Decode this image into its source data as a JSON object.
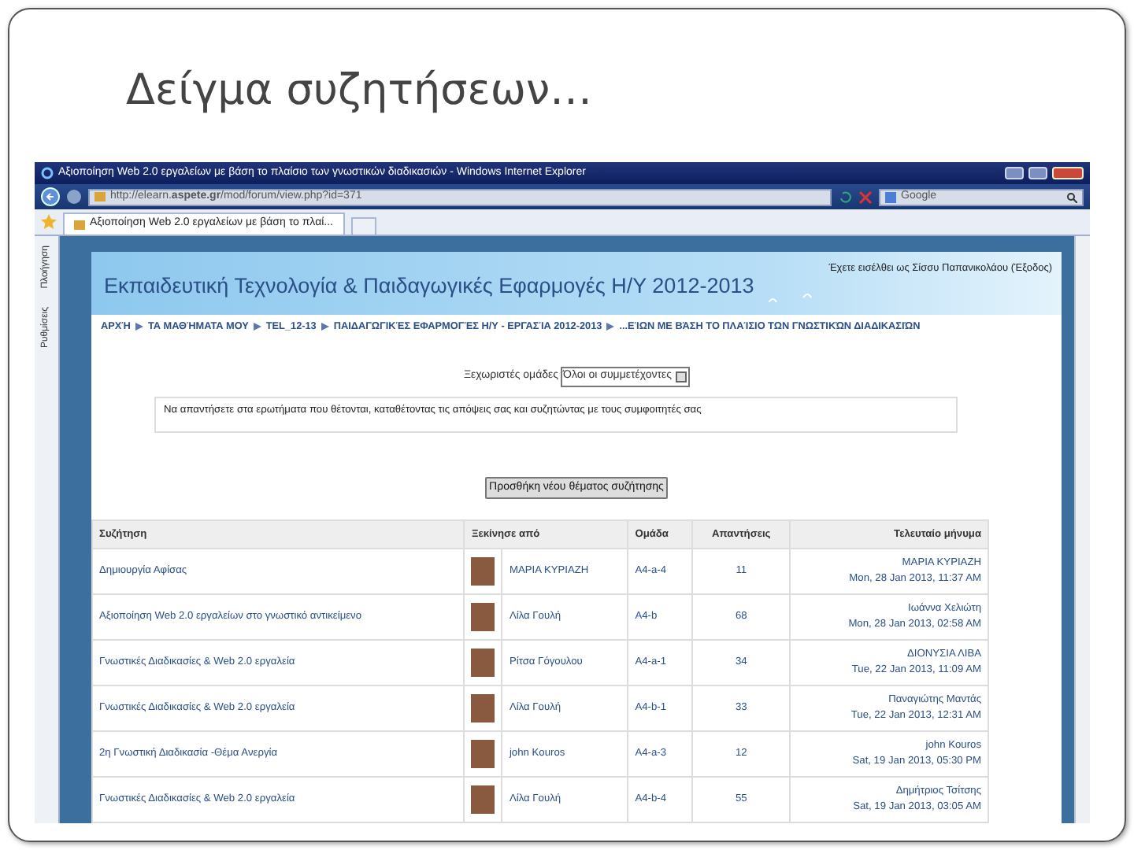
{
  "slide": {
    "title": "Δείγμα συζητήσεων…"
  },
  "browser": {
    "window_title": "Αξιοποίηση Web 2.0 εργαλείων με βάση το πλαίσιο των γνωστικών διαδικασιών - Windows Internet Explorer",
    "address": "http://elearn.**aspete.gr**/mod/forum/view.php?id=371",
    "search_placeholder": "Google",
    "tab": "Αξιοποίηση Web 2.0 εργαλείων με βάση το πλαί...",
    "side_tabs": [
      "Πλοήγηση",
      "Ρυθμίσεις"
    ]
  },
  "page": {
    "login_text": "Έχετε εισέλθει ως Σίσσυ Παπανικολάου (Έξοδος)",
    "course_title": "Εκπαιδευτική Τεχνολογία & Παιδαγωγικές Εφαρμογές Η/Υ 2012-2013",
    "breadcrumb": [
      "ΑΡΧΉ",
      "ΤΑ ΜΑΘΉΜΑΤΑ ΜΟΥ",
      "TEL_12-13",
      "ΠΑΙΔΑΓΩΓΙΚΈΣ ΕΦΑΡΜΟΓΈΣ Η/Υ - ΕΡΓΑΣΊΑ 2012-2013",
      "...ΕΊΩΝ ΜΕ ΒΆΣΗ ΤΟ ΠΛΑΊΣΙΟ ΤΩΝ ΓΝΩΣΤΙΚΏΝ ΔΙΑΔΙΚΑΣΙΏΝ"
    ],
    "groups": {
      "label": "Ξεχωριστές ομάδες",
      "value": "Όλοι οι συμμετέχοντες"
    },
    "intro": "Να απαντήσετε στα ερωτήματα που θέτονται, καταθέτοντας τις απόψεις σας και συζητώντας με τους συμφοιτητές σας",
    "add_button": "Προσθήκη νέου θέματος συζήτησης"
  },
  "table": {
    "columns": [
      "Συζήτηση",
      "Ξεκίνησε από",
      "Ομάδα",
      "Απαντήσεις",
      "Τελευταίο μήνυμα"
    ],
    "rows": [
      {
        "discussion": "Δημιουργία Αφίσας",
        "started_by": "ΜΑΡΙΑ ΚΥΡΙΑΖΗ",
        "group": "A4-a-4",
        "replies": "11",
        "last_author": "ΜΑΡΙΑ ΚΥΡΙΑΖΗ",
        "last_date": "Mon, 28 Jan 2013, 11:37 AM"
      },
      {
        "discussion": "Αξιοποίηση Web 2.0 εργαλείων στο γνωστικό αντικείμενο",
        "started_by": "Λίλα Γουλή",
        "group": "A4-b",
        "replies": "68",
        "last_author": "Ιωάννα Χελιώτη",
        "last_date": "Mon, 28 Jan 2013, 02:58 AM"
      },
      {
        "discussion": "Γνωστικές Διαδικασίες & Web 2.0 εργαλεία",
        "started_by": "Ρίτσα Γόγουλου",
        "group": "A4-a-1",
        "replies": "34",
        "last_author": "ΔΙΟΝΥΣΙΑ ΛΙΒΑ",
        "last_date": "Tue, 22 Jan 2013, 11:09 AM"
      },
      {
        "discussion": "Γνωστικές Διαδικασίες & Web 2.0 εργαλεία",
        "started_by": "Λίλα Γουλή",
        "group": "A4-b-1",
        "replies": "33",
        "last_author": "Παναγιώτης Μαντάς",
        "last_date": "Tue, 22 Jan 2013, 12:31 AM"
      },
      {
        "discussion": "2η Γνωστική Διαδικασία -Θέμα Ανεργία",
        "started_by": "john Kouros",
        "group": "A4-a-3",
        "replies": "12",
        "last_author": "john Kouros",
        "last_date": "Sat, 19 Jan 2013, 05:30 PM"
      },
      {
        "discussion": "Γνωστικές Διαδικασίες & Web 2.0 εργαλεία",
        "started_by": "Λίλα Γουλή",
        "group": "A4-b-4",
        "replies": "55",
        "last_author": "Δημήτριος Τσίτσης",
        "last_date": "Sat, 19 Jan 2013, 03:05 AM"
      }
    ]
  }
}
